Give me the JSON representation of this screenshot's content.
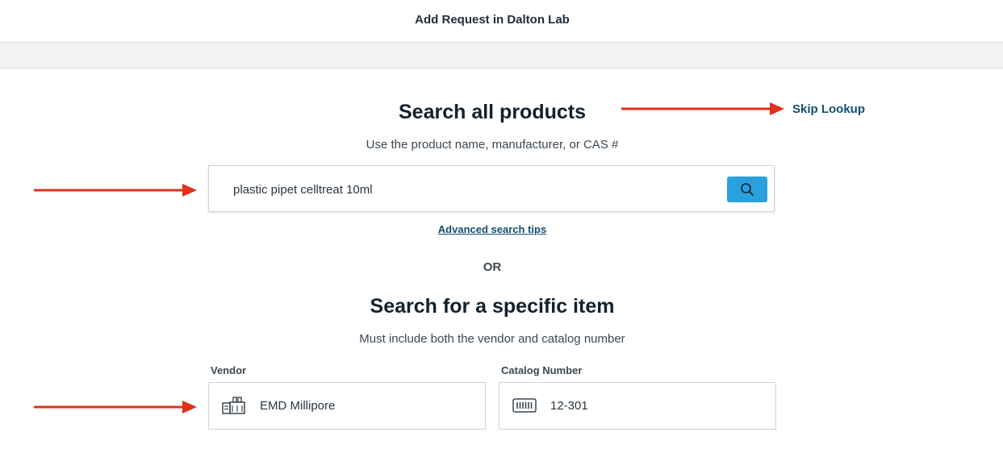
{
  "header": {
    "title": "Add Request in Dalton Lab"
  },
  "product_search": {
    "heading": "Search all products",
    "subtitle": "Use the product name, manufacturer, or CAS #",
    "skip_label": "Skip Lookup",
    "query_value": "plastic pipet celltreat 10ml",
    "button_icon": "search-icon",
    "advanced_tips_label": "Advanced search tips"
  },
  "divider_label": "OR",
  "specific_search": {
    "heading": "Search for a specific item",
    "subtitle": "Must include both the vendor and catalog number",
    "vendor": {
      "label": "Vendor",
      "value": "EMD Millipore",
      "icon": "factory-icon"
    },
    "catalog": {
      "label": "Catalog Number",
      "value": "12-301",
      "icon": "barcode-icon"
    }
  },
  "annotations": {
    "arrow_color": "#e0301e"
  },
  "colors": {
    "accent": "#2aa0de",
    "link": "#134e6f"
  }
}
